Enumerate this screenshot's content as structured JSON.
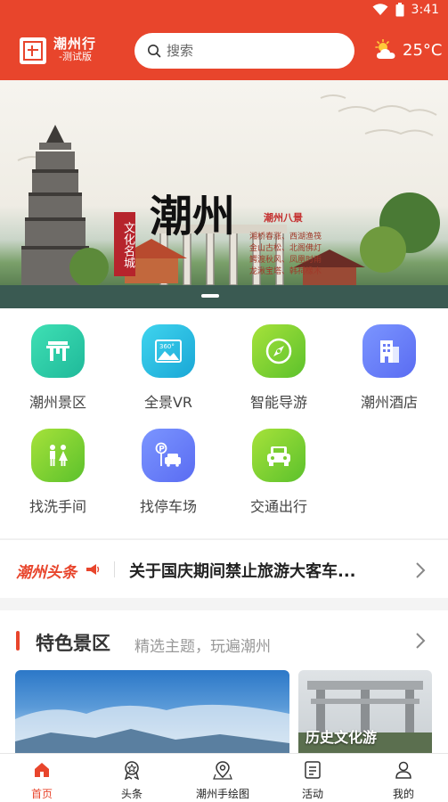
{
  "status_bar": {
    "time": "3:41"
  },
  "header": {
    "brand_title": "潮州行",
    "brand_subtitle": "-测试版",
    "search_placeholder": "搜索",
    "weather_temp": "25°C",
    "weather_icon": "partly-cloudy-icon"
  },
  "banner": {
    "title": "潮州",
    "tag": "文化名城",
    "subtitle": "潮州八景",
    "poem_lines": [
      "湘桥春涨、西湖渔筏",
      "金山古松、北阁佛灯",
      "鳄渡秋风、凤凰时雨",
      "龙湫宝塔、韩祠橡木"
    ]
  },
  "grid": {
    "items": [
      {
        "label": "潮州景区",
        "icon": "gate-icon",
        "color_from": "#3fe0b4",
        "color_to": "#1fb99a"
      },
      {
        "label": "全景VR",
        "icon": "vr-image-icon",
        "color_from": "#3fd4ee",
        "color_to": "#1aa7d6"
      },
      {
        "label": "智能导游",
        "icon": "compass-icon",
        "color_from": "#a6e23a",
        "color_to": "#5cc12c"
      },
      {
        "label": "潮州酒店",
        "icon": "hotel-icon",
        "color_from": "#7b95ff",
        "color_to": "#5a6cf2"
      },
      {
        "label": "找洗手间",
        "icon": "restroom-icon",
        "color_from": "#a6e23a",
        "color_to": "#5cc12c"
      },
      {
        "label": "找停车场",
        "icon": "parking-icon",
        "color_from": "#7b95ff",
        "color_to": "#5a6cf2"
      },
      {
        "label": "交通出行",
        "icon": "car-icon",
        "color_from": "#a6e23a",
        "color_to": "#5cc12c"
      }
    ]
  },
  "news": {
    "logo_text": "潮州头条",
    "headline": "关于国庆期间禁止旅游大客车..."
  },
  "featured": {
    "title": "特色景区",
    "subtitle": "精选主题，玩遍潮州",
    "card2_label": "历史文化游"
  },
  "tabbar": {
    "items": [
      {
        "label": "首页",
        "icon": "home-icon",
        "active": true
      },
      {
        "label": "头条",
        "icon": "headline-badge-icon",
        "active": false
      },
      {
        "label": "潮州手绘图",
        "icon": "map-pin-icon",
        "active": false
      },
      {
        "label": "活动",
        "icon": "activity-icon",
        "active": false
      },
      {
        "label": "我的",
        "icon": "user-icon",
        "active": false
      }
    ]
  },
  "colors": {
    "accent": "#e8452c"
  }
}
